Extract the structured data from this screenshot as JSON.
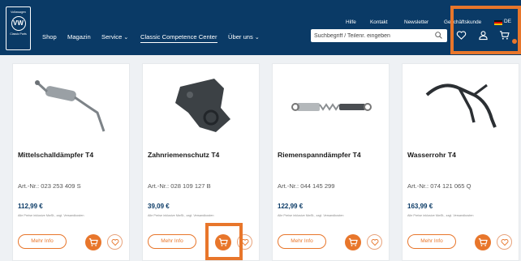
{
  "header": {
    "logo_text_top": "Volkswagen",
    "logo_text_bottom": "Classic Parts",
    "main_nav": [
      {
        "label": "Shop"
      },
      {
        "label": "Magazin"
      },
      {
        "label": "Service"
      },
      {
        "label": "Classic Competence Center"
      },
      {
        "label": "Über uns"
      }
    ],
    "meta_nav": [
      {
        "label": "Hilfe"
      },
      {
        "label": "Kontakt"
      },
      {
        "label": "Newsletter"
      },
      {
        "label": "Geschäftskunde"
      }
    ],
    "search_placeholder": "Suchbegriff / Teilenr. eingeben",
    "language": "DE",
    "icons": [
      "heart-icon",
      "user-icon",
      "cart-icon"
    ],
    "cart_has_items": true
  },
  "product_list": {
    "more_info_label": "Mehr Info",
    "products": [
      {
        "name": "Mittelschalldämpfer T4",
        "article": "Art.-Nr.: 023 253 409 S",
        "price": "112,99 €",
        "note": "Alle Preise inklusive MwSt., zzgl. Versandkosten"
      },
      {
        "name": "Zahnriemenschutz T4",
        "article": "Art.-Nr.: 028 109 127 B",
        "price": "39,09 €",
        "note": "Alle Preise inklusive MwSt., zzgl. Versandkosten"
      },
      {
        "name": "Riemenspanndämpfer T4",
        "article": "Art.-Nr.: 044 145 299",
        "price": "122,99 €",
        "note": "Alle Preise inklusive MwSt., zzgl. Versandkosten"
      },
      {
        "name": "Wasserrohr T4",
        "article": "Art.-Nr.: 074 121 065 Q",
        "price": "163,99 €",
        "note": "Alle Preise inklusive MwSt., zzgl. Versandkosten"
      }
    ]
  },
  "colors": {
    "header_bg": "#0a3a66",
    "accent": "#e8762b",
    "price": "#0a3a66"
  }
}
